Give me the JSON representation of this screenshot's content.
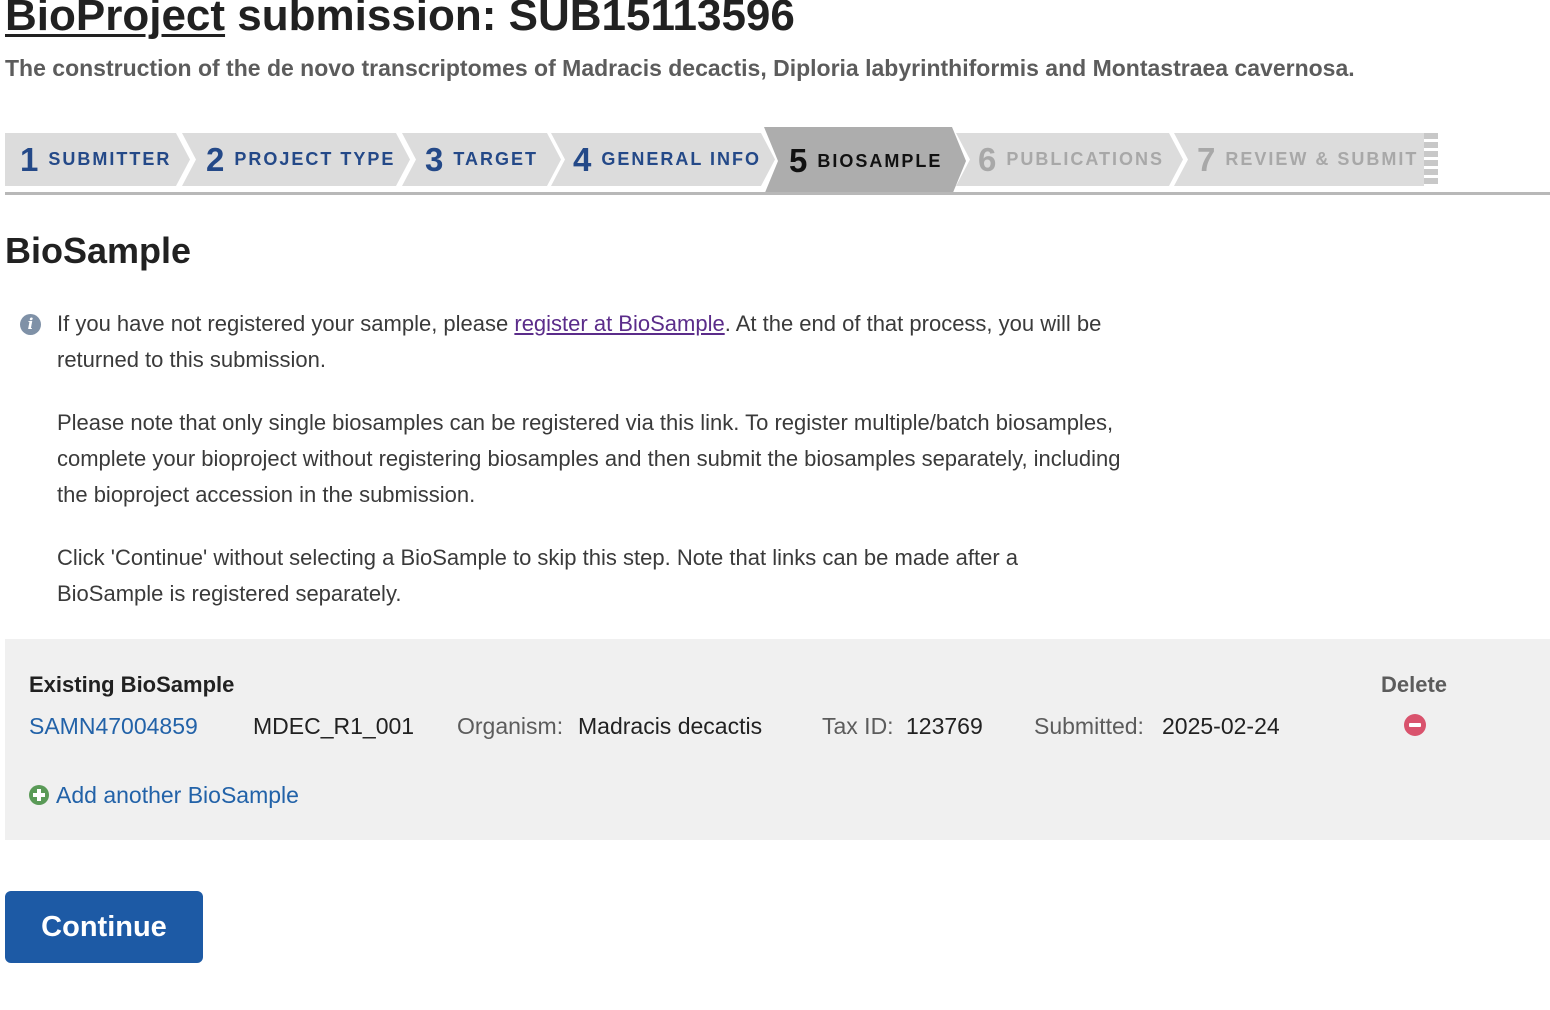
{
  "header": {
    "title_link": "BioProject",
    "title_rest": " submission: SUB15113596",
    "subtitle": "The construction of the de novo transcriptomes of Madracis decactis, Diploria labyrinthiformis and Montastraea cavernosa."
  },
  "steps": [
    {
      "num": "1",
      "label": "SUBMITTER",
      "state": "done"
    },
    {
      "num": "2",
      "label": "PROJECT TYPE",
      "state": "done"
    },
    {
      "num": "3",
      "label": "TARGET",
      "state": "done"
    },
    {
      "num": "4",
      "label": "GENERAL INFO",
      "state": "done"
    },
    {
      "num": "5",
      "label": "BIOSAMPLE",
      "state": "active"
    },
    {
      "num": "6",
      "label": "PUBLICATIONS",
      "state": "todo"
    },
    {
      "num": "7",
      "label": "REVIEW & SUBMIT",
      "state": "todo"
    }
  ],
  "section": {
    "title": "BioSample"
  },
  "info": {
    "icon": "info-icon",
    "p1_before": "If you have not registered your sample, please ",
    "p1_link": "register at BioSample",
    "p1_after": ". At the end of that process, you will be returned to this submission.",
    "p2": "Please note that only single biosamples can be registered via this link. To register multiple/batch biosamples, complete your bioproject without registering biosamples and then submit the biosamples separately, including the bioproject accession in the submission.",
    "p3": "Click 'Continue' without selecting a BioSample to skip this step. Note that links can be made after a BioSample is registered separately."
  },
  "samples": {
    "header_existing": "Existing BioSample",
    "header_delete": "Delete",
    "row": {
      "accession": "SAMN47004859",
      "sample_name": "MDEC_R1_001",
      "organism_label": "Organism:",
      "organism": "Madracis decactis",
      "taxid_label": "Tax ID:",
      "taxid": "123769",
      "submitted_label": "Submitted:",
      "submitted": "2025-02-24"
    },
    "add_label": "Add another BioSample"
  },
  "actions": {
    "continue_label": "Continue"
  },
  "colors": {
    "step_done": "#244988",
    "link": "#2262a8",
    "delete": "#d9536d",
    "add": "#5a9a57",
    "button": "#1d5aa5"
  }
}
